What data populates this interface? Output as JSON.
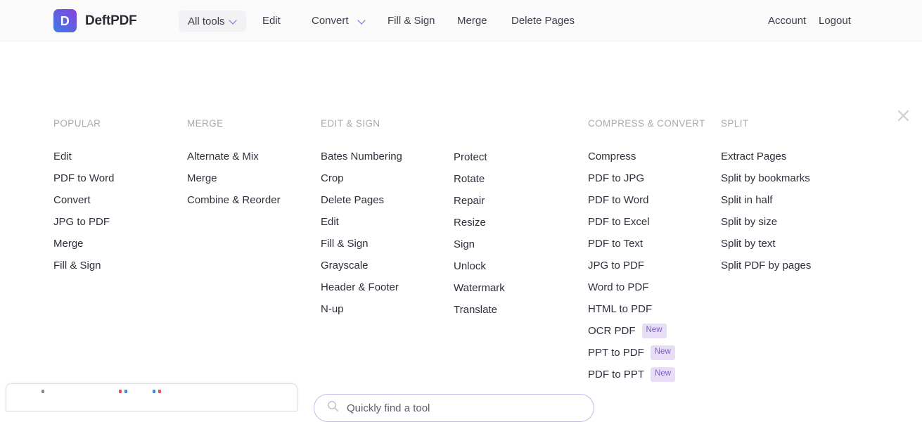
{
  "header": {
    "logo_letter": "D",
    "brand": "DeftPDF",
    "all_tools": "All tools",
    "nav": {
      "edit": "Edit",
      "convert": "Convert",
      "fill_sign": "Fill & Sign",
      "merge": "Merge",
      "delete_pages": "Delete Pages",
      "account": "Account",
      "logout": "Logout"
    }
  },
  "panel": {
    "columns": {
      "popular": {
        "heading": "POPULAR",
        "items": [
          {
            "label": "Edit"
          },
          {
            "label": "PDF to Word"
          },
          {
            "label": "Convert"
          },
          {
            "label": "JPG to PDF"
          },
          {
            "label": "Merge"
          },
          {
            "label": "Fill & Sign"
          }
        ]
      },
      "merge": {
        "heading": "MERGE",
        "items": [
          {
            "label": "Alternate & Mix"
          },
          {
            "label": "Merge"
          },
          {
            "label": "Combine & Reorder"
          }
        ]
      },
      "edit_sign": {
        "heading": "EDIT & SIGN",
        "items": [
          {
            "label": "Bates Numbering"
          },
          {
            "label": "Crop"
          },
          {
            "label": "Delete Pages"
          },
          {
            "label": "Edit"
          },
          {
            "label": "Fill & Sign"
          },
          {
            "label": "Grayscale"
          },
          {
            "label": "Header & Footer"
          },
          {
            "label": "N-up"
          }
        ],
        "items2": [
          {
            "label": "Protect"
          },
          {
            "label": "Rotate"
          },
          {
            "label": "Repair"
          },
          {
            "label": "Resize"
          },
          {
            "label": "Sign"
          },
          {
            "label": "Unlock"
          },
          {
            "label": "Watermark"
          },
          {
            "label": "Translate"
          }
        ]
      },
      "compress_convert": {
        "heading": "COMPRESS & CONVERT",
        "items": [
          {
            "label": "Compress"
          },
          {
            "label": "PDF to JPG"
          },
          {
            "label": "PDF to Word"
          },
          {
            "label": "PDF to Excel"
          },
          {
            "label": "PDF to Text"
          },
          {
            "label": "JPG to PDF"
          },
          {
            "label": "Word to PDF"
          },
          {
            "label": "HTML to PDF"
          },
          {
            "label": "OCR PDF",
            "badge": "New"
          },
          {
            "label": "PPT to PDF",
            "badge": "New"
          },
          {
            "label": "PDF to PPT",
            "badge": "New"
          }
        ]
      },
      "split": {
        "heading": "SPLIT",
        "items": [
          {
            "label": "Extract Pages"
          },
          {
            "label": "Split by bookmarks"
          },
          {
            "label": "Split in half"
          },
          {
            "label": "Split by size"
          },
          {
            "label": "Split by text"
          },
          {
            "label": "Split PDF by pages"
          }
        ]
      }
    }
  },
  "search": {
    "placeholder": "Quickly find a tool",
    "value": ""
  },
  "colors": {
    "accent_purple": "#7b5fd0",
    "badge_bg": "#e7ddf5",
    "badge_text": "#7a5fc0",
    "header_bg": "#fafafa",
    "heading_gray": "#a9a9b2",
    "search_border": "#c9b8e8"
  }
}
